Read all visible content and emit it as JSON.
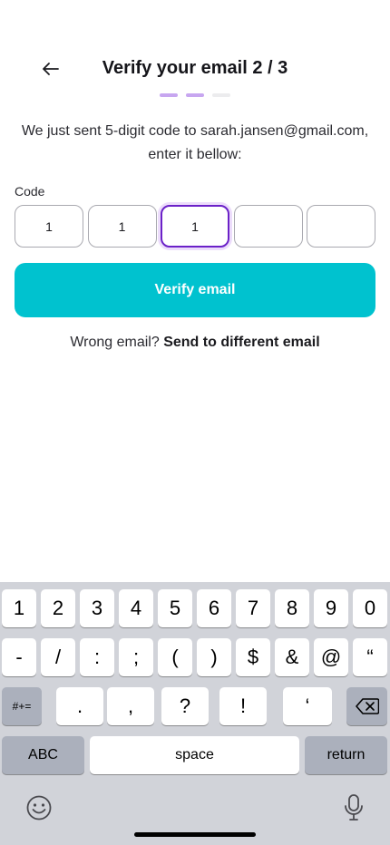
{
  "header": {
    "title": "Verify your email 2 / 3"
  },
  "progress": {
    "steps": 3,
    "current": 2,
    "active_color": "#c7a6f0",
    "inactive_color": "#ececee"
  },
  "subtitle": {
    "line1": "We just sent 5-digit code to sarah.jansen@gmail.com,",
    "line2": "enter it bellow:"
  },
  "code": {
    "label": "Code",
    "digits": [
      "1",
      "1",
      "1",
      "",
      ""
    ],
    "focused_index": 2,
    "focus_color": "#6b21c8"
  },
  "verify_button": {
    "label": "Verify email",
    "color": "#00c2cf"
  },
  "wrong_email": {
    "prompt": "Wrong email?",
    "link": "Send to different email"
  },
  "keyboard": {
    "row1": [
      "1",
      "2",
      "3",
      "4",
      "5",
      "6",
      "7",
      "8",
      "9",
      "0"
    ],
    "row2": [
      "-",
      "/",
      ":",
      ";",
      "(",
      ")",
      "$",
      "&",
      "@",
      "“"
    ],
    "row3_left": "#+=",
    "row3": [
      ".",
      ",",
      "?",
      "!",
      "‘"
    ],
    "abc": "ABC",
    "space": "space",
    "return": "return",
    "icons": [
      "backspace-icon",
      "emoji-icon",
      "microphone-icon"
    ]
  }
}
